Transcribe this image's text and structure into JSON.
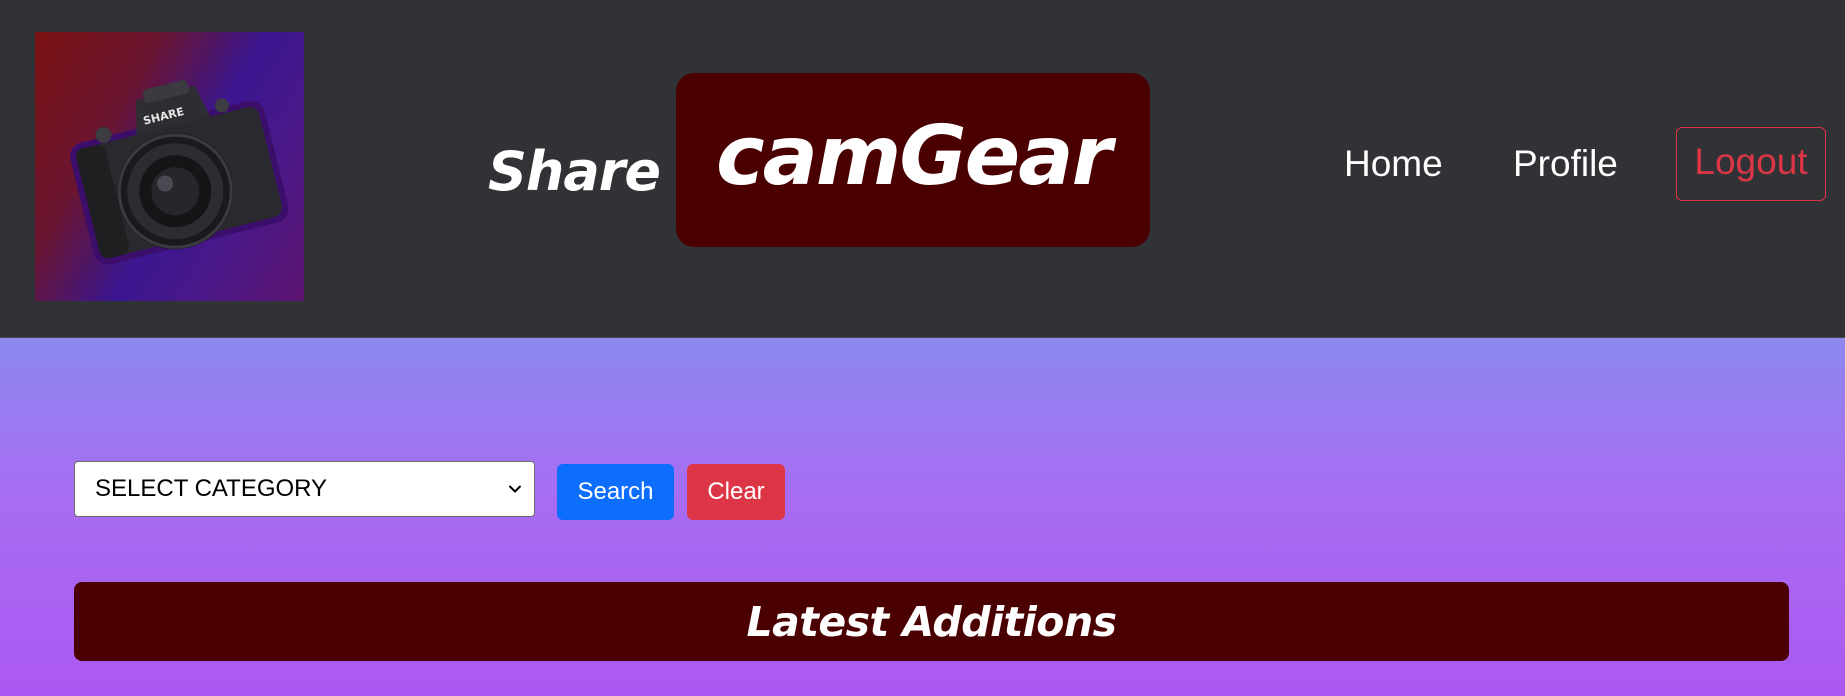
{
  "header": {
    "logo_name": "camera-logo",
    "logo_badge": "SHARE",
    "brand_prefix": "Share",
    "brand_name": "camGear",
    "nav": {
      "home": "Home",
      "profile": "Profile",
      "logout": "Logout"
    }
  },
  "filters": {
    "category_select": "SELECT CATEGORY",
    "search_label": "Search",
    "clear_label": "Clear"
  },
  "section": {
    "title": "Latest Additions"
  },
  "colors": {
    "navbar_bg": "#303236",
    "brand_box": "#4a0000",
    "search_btn": "#0d6efd",
    "clear_btn": "#dc3545",
    "logout_accent": "#dc3545",
    "bg_gradient_top": "#8c88f0",
    "bg_gradient_bottom": "#ab58f2"
  }
}
